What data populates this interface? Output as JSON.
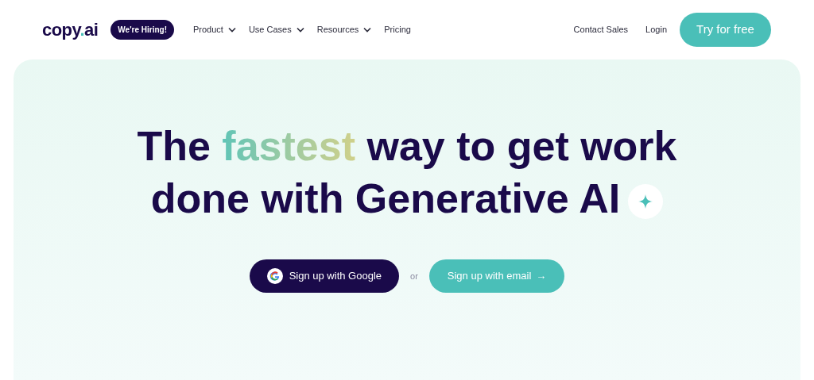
{
  "logo": {
    "parts": [
      "copy",
      ".",
      "ai"
    ]
  },
  "hiring_badge": "We're Hiring!",
  "nav": [
    {
      "label": "Product",
      "dropdown": true
    },
    {
      "label": "Use Cases",
      "dropdown": true
    },
    {
      "label": "Resources",
      "dropdown": true
    },
    {
      "label": "Pricing",
      "dropdown": false
    }
  ],
  "nav_right": [
    "Contact Sales",
    "Login"
  ],
  "cta": "Try for free",
  "hero": {
    "headline_start": "The ",
    "headline_highlight": "fastest",
    "headline_end": " way to get work done with Generative AI",
    "google_button": "Sign up with Google",
    "separator": "or",
    "email_button": "Sign up with email",
    "email_arrow": "→"
  }
}
